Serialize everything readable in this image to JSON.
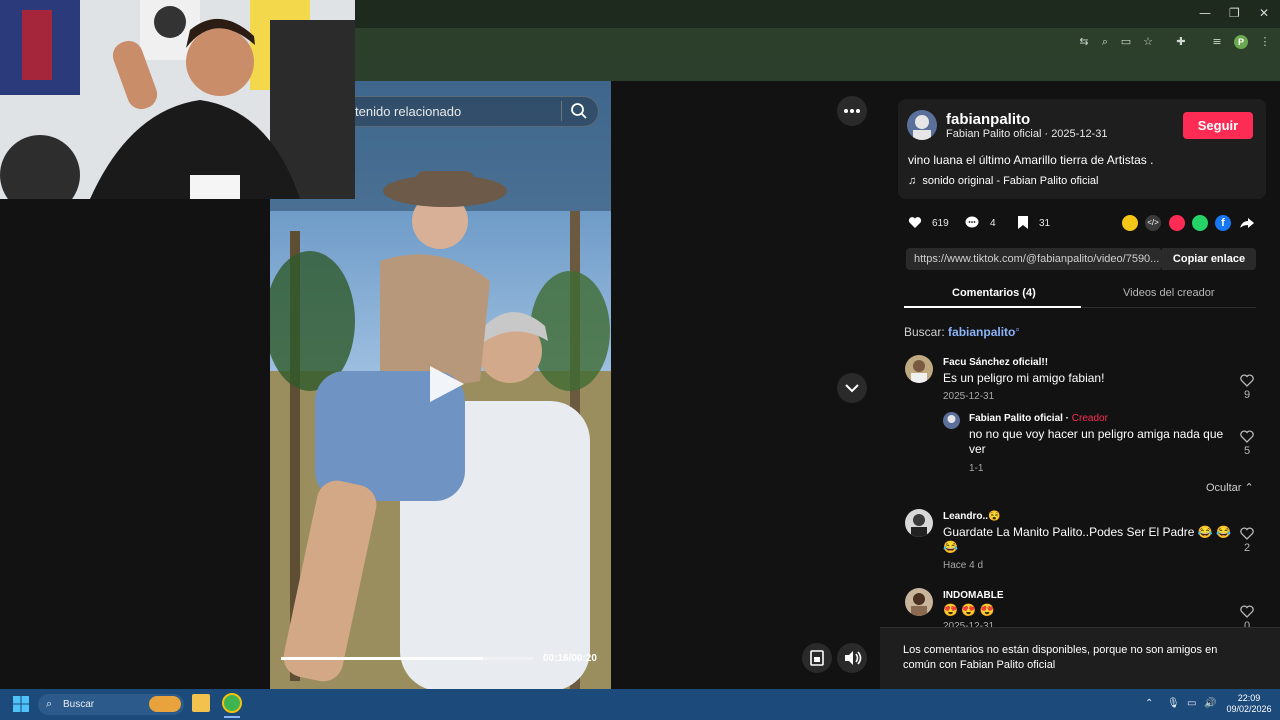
{
  "browser": {
    "window_controls": {
      "minimize": "—",
      "restore": "❐",
      "close": "✕"
    },
    "toolbar_icons": [
      "translate-icon",
      "zoom-icon",
      "cast-icon",
      "bookmark-star-icon",
      "extensions-icon",
      "media-icon",
      "profile-avatar",
      "menu-icon"
    ],
    "profile_initial": "P"
  },
  "player": {
    "search_placeholder": "tenido relacionado",
    "time": "00:16/00:20",
    "progress": 0.8
  },
  "post": {
    "username": "fabianpalito",
    "display_name": "Fabian Palito oficial",
    "date": "2025-12-31",
    "separator": "·",
    "follow_label": "Seguir",
    "description": "vino luana el último Amarillo tierra de Artistas .",
    "sound_label": "sonido original - Fabian Palito oficial",
    "likes": "619",
    "comments": "4",
    "saves": "31",
    "link": "https://www.tiktok.com/@fabianpalito/video/7590...",
    "copy_link_label": "Copiar enlace"
  },
  "tabs": [
    {
      "label": "Comentarios (4)",
      "active": true
    },
    {
      "label": "Videos del creador",
      "active": false
    }
  ],
  "search_suggestion": {
    "prefix": "Buscar:",
    "term": "fabianpalito"
  },
  "comments": [
    {
      "author": "Facu Sánchez oficial!!",
      "text": "Es un peligro mi amigo fabian!",
      "date": "2025-12-31",
      "likes": "9"
    },
    {
      "author": "Fabian Palito oficial",
      "tag": "Creador",
      "text_line1": "no no que voy hacer un peligro amiga nada que",
      "text_line2": "ver",
      "date": "1-1",
      "likes": "5"
    },
    {
      "author": "Leandro..😵",
      "text_line1": "Guardate La Manito Palito..Podes Ser El Padre 😂 😂",
      "text_line2": "😂",
      "date": "Hace 4 d",
      "likes": "2"
    },
    {
      "author": "INDOMABLE",
      "text": "😍 😍 😍",
      "date": "2025-12-31",
      "likes": "0"
    }
  ],
  "hide_label": "Ocultar",
  "footer_notice": "Los comentarios no están disponibles, porque no son amigos en común con Fabian Palito oficial",
  "taskbar": {
    "search_label": "Buscar",
    "time": "22:09",
    "date": "09/02/2026"
  },
  "colors": {
    "accent": "#fe2c55",
    "link": "#8ab4f8",
    "taskbar": "#1c4a7a"
  }
}
